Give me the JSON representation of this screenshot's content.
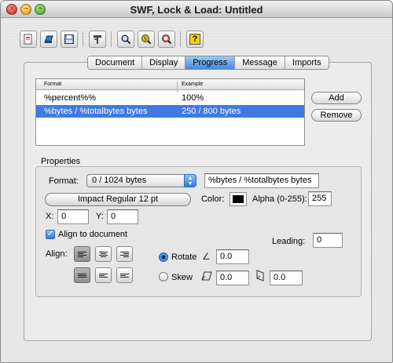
{
  "window": {
    "title": "SWF, Lock & Load: Untitled"
  },
  "toolbar": {
    "buttons": [
      {
        "icon": "new-document-icon"
      },
      {
        "icon": "open-document-icon"
      },
      {
        "icon": "save-icon"
      },
      {
        "icon": "settings-icon"
      },
      {
        "icon": "zoom-icon"
      },
      {
        "icon": "export-icon"
      },
      {
        "icon": "import-icon"
      },
      {
        "icon": "help-icon",
        "glyph": "?"
      }
    ]
  },
  "tabs": [
    {
      "label": "Document",
      "active": false
    },
    {
      "label": "Display",
      "active": false
    },
    {
      "label": "Progress",
      "active": true
    },
    {
      "label": "Message",
      "active": false
    },
    {
      "label": "Imports",
      "active": false
    }
  ],
  "format_list": {
    "columns": [
      "Format",
      "Example"
    ],
    "rows": [
      {
        "format": "%percent%%",
        "example": "100%",
        "selected": false
      },
      {
        "format": "%bytes / %totalbytes bytes",
        "example": "250 / 800 bytes",
        "selected": true
      }
    ]
  },
  "list_buttons": {
    "add": "Add",
    "remove": "Remove"
  },
  "properties": {
    "group_label": "Properties",
    "format_label": "Format:",
    "format_value": "0 / 1024 bytes",
    "format_text": "%bytes / %totalbytes bytes",
    "font_button": "Impact Regular 12 pt",
    "color_label": "Color:",
    "color_value": "#000000",
    "alpha_label": "Alpha (0-255):",
    "alpha_value": "255",
    "x_label": "X:",
    "x_value": "0",
    "y_label": "Y:",
    "y_value": "0",
    "align_to_document_label": "Align to document",
    "align_to_document_checked": true,
    "leading_label": "Leading:",
    "leading_value": "0",
    "align_label": "Align:",
    "rotate_label": "Rotate",
    "rotate_value": "0.0",
    "skew_label": "Skew",
    "skew_x_value": "0.0",
    "skew_y_value": "0.0",
    "transform_mode": "rotate"
  }
}
